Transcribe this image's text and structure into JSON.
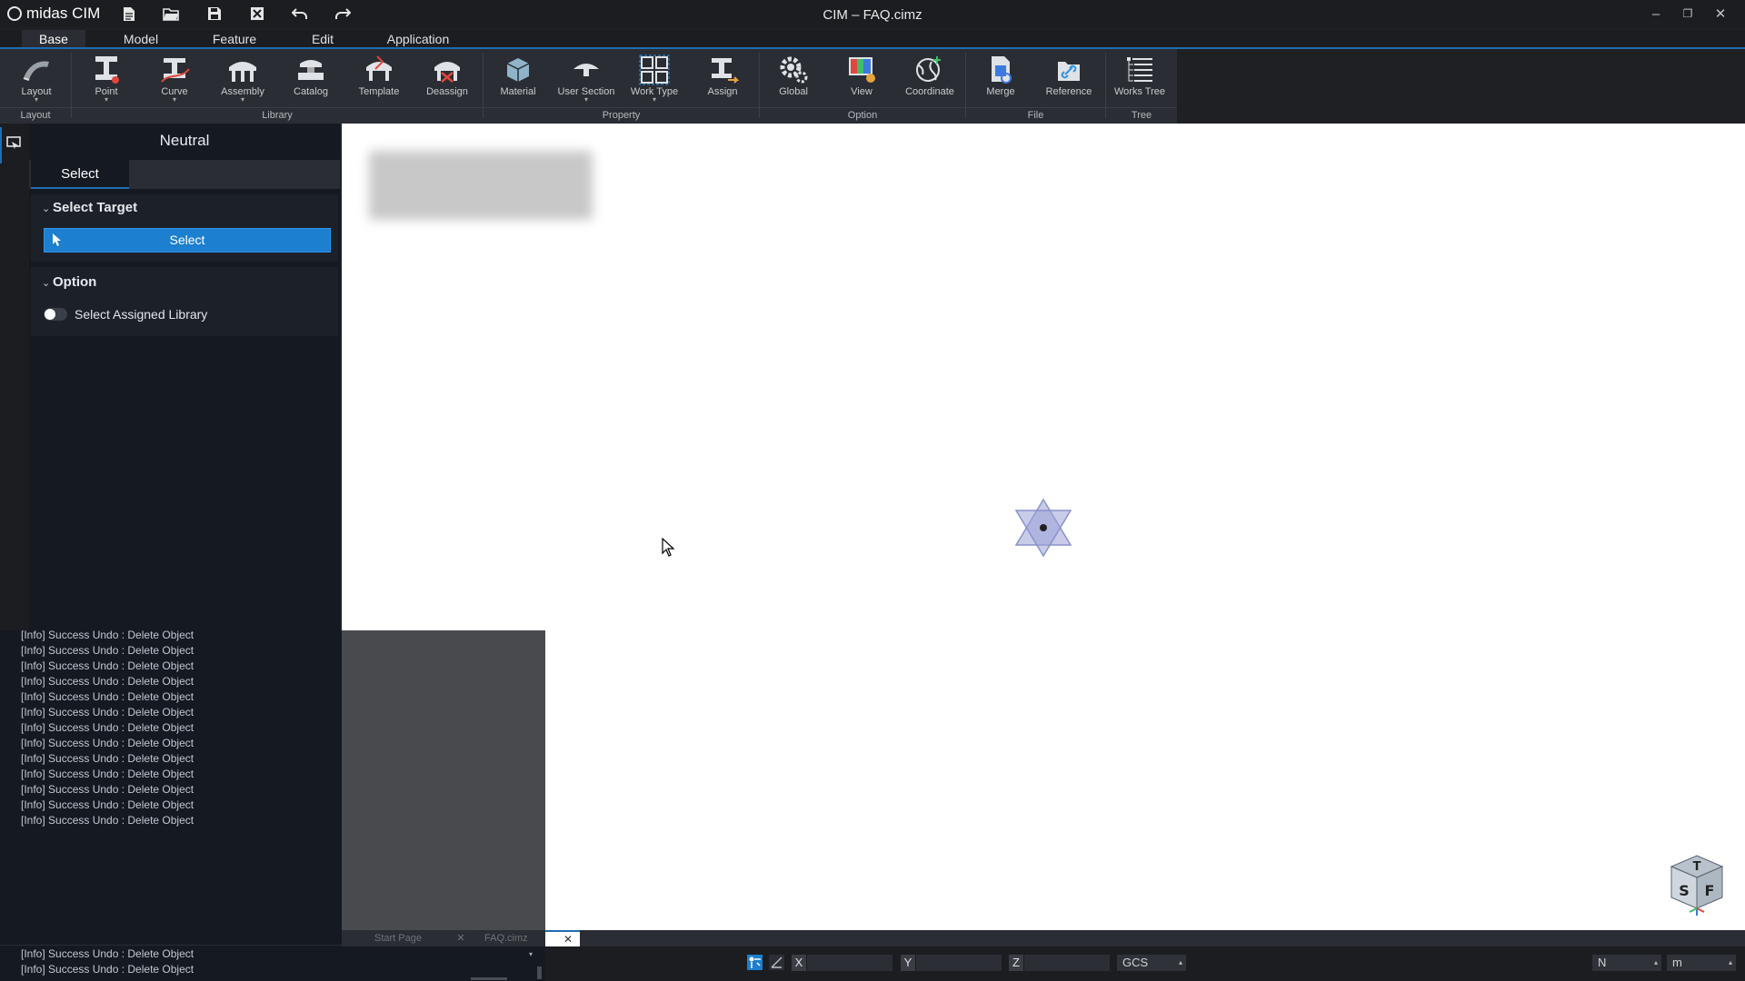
{
  "app": {
    "brand": "midas CIM",
    "window_title": "CIM – FAQ.cimz",
    "accent_color": "#1f6db3",
    "quick_access": [
      {
        "name": "new-file-icon",
        "glyph": "🗎"
      },
      {
        "name": "open-folder-icon",
        "glyph": "🗁"
      },
      {
        "name": "save-icon",
        "glyph": "💾"
      },
      {
        "name": "close-file-icon",
        "glyph": "☒"
      },
      {
        "name": "undo-icon",
        "glyph": "↶"
      },
      {
        "name": "redo-icon",
        "glyph": "↷"
      }
    ],
    "window_controls": {
      "minimize": "–",
      "restore": "❐",
      "close": "✕"
    }
  },
  "menu": {
    "tabs": [
      "Base",
      "Model",
      "Feature",
      "Edit",
      "Application"
    ],
    "active": "Base"
  },
  "ribbon": {
    "groups": {
      "layout": "Layout",
      "library": "Library",
      "property": "Property",
      "option": "Option",
      "file": "File",
      "tree": "Tree"
    },
    "buttons": {
      "layout": "Layout",
      "point": "Point",
      "curve": "Curve",
      "assembly": "Assembly",
      "catalog": "Catalog",
      "template": "Template",
      "deassign": "Deassign",
      "material": "Material",
      "user_section": "User Section",
      "work_type": "Work Type",
      "assign": "Assign",
      "global": "Global",
      "view": "View",
      "coordinate": "Coordinate",
      "merge": "Merge",
      "reference": "Reference",
      "works_tree": "Works Tree"
    },
    "dropdown_glyph": "▾"
  },
  "panel": {
    "title": "Neutral",
    "tab": "Select",
    "select_target": {
      "header": "Select Target",
      "button": "Select"
    },
    "option": {
      "header": "Option",
      "toggle_label": "Select Assigned Library",
      "toggle_on": false
    },
    "chevron": "⌄"
  },
  "console": {
    "lines": [
      "[Info] Success Undo : Delete Object",
      "[Info] Success Undo : Delete Object",
      "[Info] Success Undo : Delete Object",
      "[Info] Success Undo : Delete Object",
      "[Info] Success Undo : Delete Object",
      "[Info] Success Undo : Delete Object",
      "[Info] Success Undo : Delete Object",
      "[Info] Success Undo : Delete Object",
      "[Info] Success Undo : Delete Object",
      "[Info] Success Undo : Delete Object",
      "[Info] Success Undo : Delete Object",
      "[Info] Success Undo : Delete Object",
      "[Info] Success Undo : Delete Object"
    ],
    "bottom_lines": [
      "[Info] Success Undo : Delete Object",
      "[Info] Success Undo : Delete Object"
    ]
  },
  "doc_tabs": {
    "start_page": "Start Page",
    "faq": "FAQ.cimz",
    "close": "✕"
  },
  "viewcube": {
    "top": "T",
    "side": "S",
    "front": "F"
  },
  "status": {
    "x_label": "X",
    "y_label": "Y",
    "z_label": "Z",
    "x_value": "",
    "y_value": "",
    "z_value": "",
    "coordinate_system": "GCS",
    "force_unit": "N",
    "length_unit": "m",
    "arrow": "▴"
  }
}
